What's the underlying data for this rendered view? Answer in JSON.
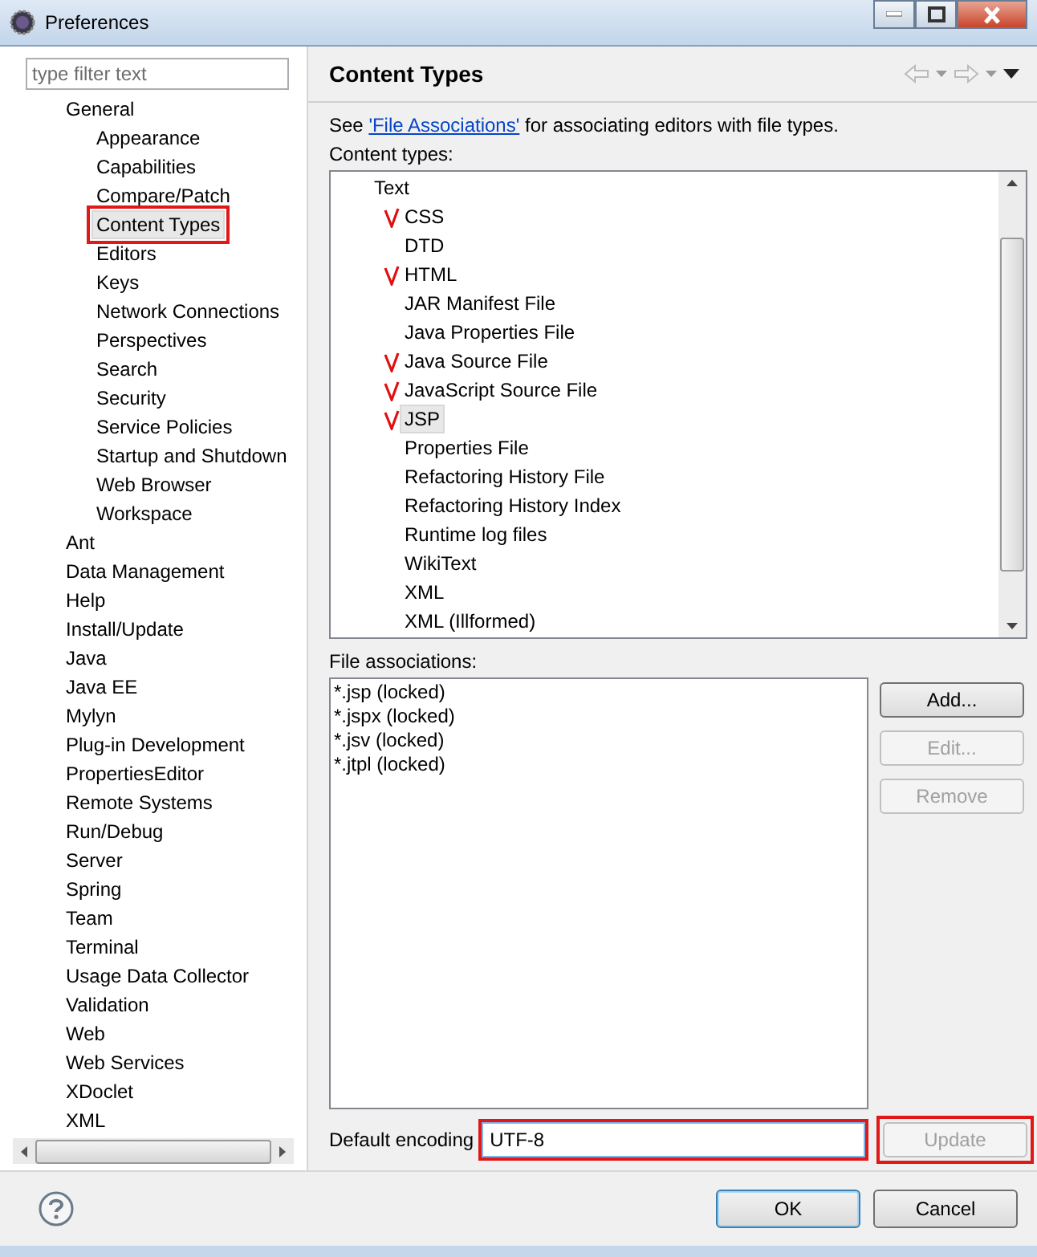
{
  "window": {
    "title": "Preferences"
  },
  "filter": {
    "placeholder": "type filter text"
  },
  "tree": [
    {
      "label": "General",
      "selected": false,
      "annotated": false,
      "children": [
        {
          "label": "Appearance",
          "selected": false,
          "annotated": false
        },
        {
          "label": "Capabilities",
          "selected": false,
          "annotated": false
        },
        {
          "label": "Compare/Patch",
          "selected": false,
          "annotated": false
        },
        {
          "label": "Content Types",
          "selected": true,
          "annotated": true
        },
        {
          "label": "Editors",
          "selected": false,
          "annotated": false
        },
        {
          "label": "Keys",
          "selected": false,
          "annotated": false
        },
        {
          "label": "Network Connections",
          "selected": false,
          "annotated": false
        },
        {
          "label": "Perspectives",
          "selected": false,
          "annotated": false
        },
        {
          "label": "Search",
          "selected": false,
          "annotated": false
        },
        {
          "label": "Security",
          "selected": false,
          "annotated": false
        },
        {
          "label": "Service Policies",
          "selected": false,
          "annotated": false
        },
        {
          "label": "Startup and Shutdown",
          "selected": false,
          "annotated": false
        },
        {
          "label": "Web Browser",
          "selected": false,
          "annotated": false
        },
        {
          "label": "Workspace",
          "selected": false,
          "annotated": false
        }
      ]
    },
    {
      "label": "Ant",
      "selected": false,
      "annotated": false
    },
    {
      "label": "Data Management",
      "selected": false,
      "annotated": false
    },
    {
      "label": "Help",
      "selected": false,
      "annotated": false
    },
    {
      "label": "Install/Update",
      "selected": false,
      "annotated": false
    },
    {
      "label": "Java",
      "selected": false,
      "annotated": false
    },
    {
      "label": "Java EE",
      "selected": false,
      "annotated": false
    },
    {
      "label": "Mylyn",
      "selected": false,
      "annotated": false
    },
    {
      "label": "Plug-in Development",
      "selected": false,
      "annotated": false
    },
    {
      "label": "PropertiesEditor",
      "selected": false,
      "annotated": false
    },
    {
      "label": "Remote Systems",
      "selected": false,
      "annotated": false
    },
    {
      "label": "Run/Debug",
      "selected": false,
      "annotated": false
    },
    {
      "label": "Server",
      "selected": false,
      "annotated": false
    },
    {
      "label": "Spring",
      "selected": false,
      "annotated": false
    },
    {
      "label": "Team",
      "selected": false,
      "annotated": false
    },
    {
      "label": "Terminal",
      "selected": false,
      "annotated": false
    },
    {
      "label": "Usage Data Collector",
      "selected": false,
      "annotated": false
    },
    {
      "label": "Validation",
      "selected": false,
      "annotated": false
    },
    {
      "label": "Web",
      "selected": false,
      "annotated": false
    },
    {
      "label": "Web Services",
      "selected": false,
      "annotated": false
    },
    {
      "label": "XDoclet",
      "selected": false,
      "annotated": false
    },
    {
      "label": "XML",
      "selected": false,
      "annotated": false
    }
  ],
  "page": {
    "title": "Content Types",
    "description": {
      "before": "See ",
      "link": "'File Associations'",
      "after": " for associating editors with file types."
    },
    "content_types": {
      "label": "Content types:",
      "items": [
        {
          "label": "Text",
          "selected": false,
          "children": [
            {
              "label": "CSS",
              "selected": false,
              "ticked": true
            },
            {
              "label": "DTD",
              "selected": false,
              "ticked": false
            },
            {
              "label": "HTML",
              "selected": false,
              "ticked": true
            },
            {
              "label": "JAR Manifest File",
              "selected": false,
              "ticked": false
            },
            {
              "label": "Java Properties File",
              "selected": false,
              "ticked": false
            },
            {
              "label": "Java Source File",
              "selected": false,
              "ticked": true
            },
            {
              "label": "JavaScript Source File",
              "selected": false,
              "ticked": true
            },
            {
              "label": "JSP",
              "selected": true,
              "ticked": true
            },
            {
              "label": "Properties File",
              "selected": false,
              "ticked": false
            },
            {
              "label": "Refactoring History File",
              "selected": false,
              "ticked": false
            },
            {
              "label": "Refactoring History Index",
              "selected": false,
              "ticked": false
            },
            {
              "label": "Runtime log files",
              "selected": false,
              "ticked": false
            },
            {
              "label": "WikiText",
              "selected": false,
              "ticked": false
            },
            {
              "label": "XML",
              "selected": false,
              "ticked": false
            },
            {
              "label": "XML (Illformed)",
              "selected": false,
              "ticked": false
            }
          ]
        }
      ]
    },
    "file_associations": {
      "label": "File associations:",
      "items": [
        {
          "label": "*.jsp (locked)",
          "selected": false
        },
        {
          "label": "*.jspx (locked)",
          "selected": false
        },
        {
          "label": "*.jsv (locked)",
          "selected": false
        },
        {
          "label": "*.jtpl (locked)",
          "selected": false
        }
      ],
      "buttons": [
        {
          "label": "Add...",
          "disabled": false
        },
        {
          "label": "Edit...",
          "disabled": true
        },
        {
          "label": "Remove",
          "disabled": true
        }
      ]
    },
    "encoding": {
      "label": "Default encoding",
      "value": "UTF-8",
      "annotated": true
    },
    "update_button": {
      "label": "Update",
      "disabled": true,
      "annotated": true
    }
  },
  "footer_buttons": [
    {
      "label": "OK",
      "default": true
    },
    {
      "label": "Cancel",
      "default": false
    }
  ]
}
